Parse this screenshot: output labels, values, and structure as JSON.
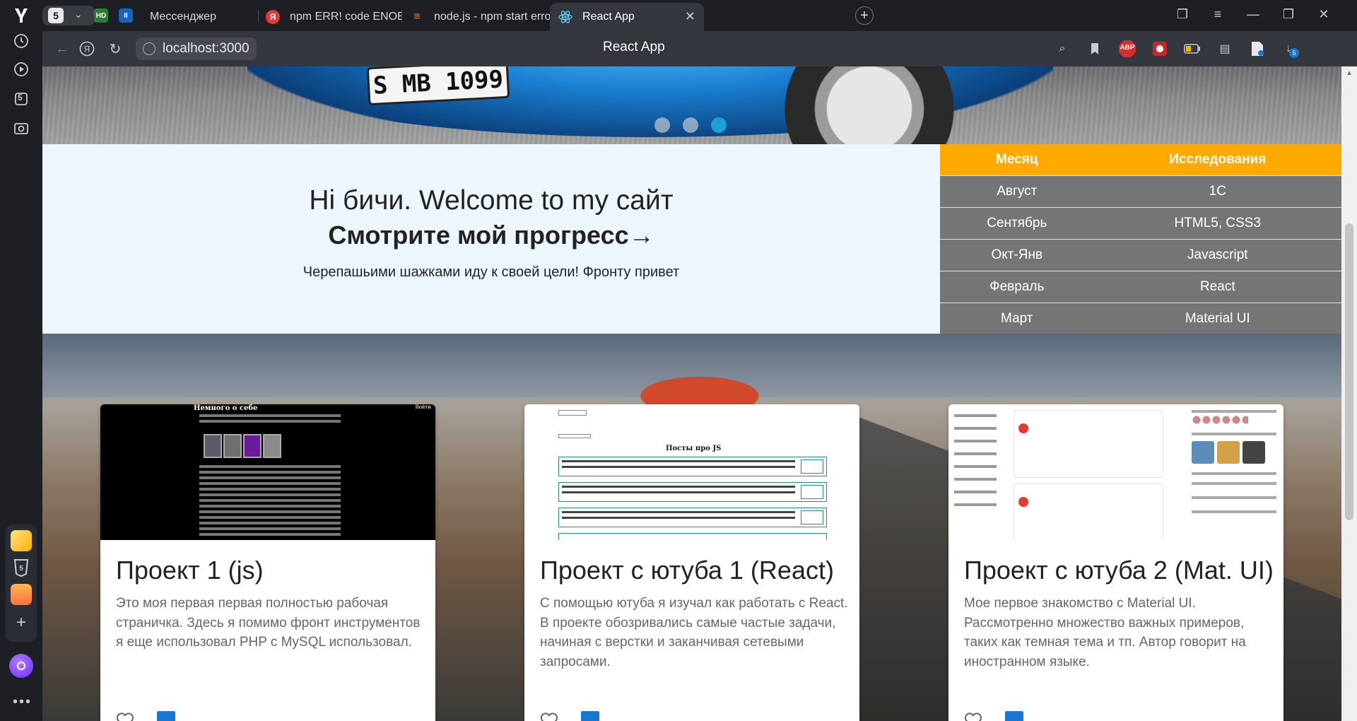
{
  "browser": {
    "tab_count": "5",
    "tabs": [
      {
        "label": "Мессенджер"
      },
      {
        "label": "npm ERR! code ENOENT npm"
      },
      {
        "label": "node.js - npm start errors w"
      },
      {
        "label": "React App"
      }
    ],
    "url": "localhost:3000",
    "page_title": "React App",
    "ext_badges": {
      "abp": "ABP",
      "downloads": "5"
    },
    "sidebar_badge": "5"
  },
  "hero": {
    "plate": "S MB 1099"
  },
  "welcome": {
    "line1": "Hi бичи. Welcome to my сайт",
    "line2": "Смотрите мой прогресс→",
    "line3": "Черепашьими шажками иду к своей цели! Фронту привет"
  },
  "study_table": {
    "headers": [
      "Месяц",
      "Исследования"
    ],
    "rows": [
      [
        "Август",
        "1С"
      ],
      [
        "Сентябрь",
        "HTML5, CSS3"
      ],
      [
        "Окт-Янв",
        "Javascript"
      ],
      [
        "Февраль",
        "React"
      ],
      [
        "Март",
        "Material UI"
      ]
    ]
  },
  "projects": [
    {
      "title": "Проект 1 (js)",
      "desc": "Это моя первая первая полностью рабочая страничка. Здесь я помимо фронт инструментов я еще использовал PHP с MySQL использовал.",
      "thumb_title": "Немного о себе",
      "thumb_login": "Войти"
    },
    {
      "title": "Проект с ютуба 1 (React)",
      "desc": "С помощью ютуба я изучал как работать с React. В проекте обозривались самые частые задачи, начиная с верстки и заканчивая сетевыми запросами.",
      "thumb_title": "Посты про JS"
    },
    {
      "title": "Проект с ютуба 2 (Mat. UI)",
      "desc": "Мое первое знакомство с Material UI. Рассмотренно множество важных примеров, таких как темная тема и тп. Автор говорит на иностранном языке."
    }
  ],
  "colors": {
    "table_header": "#ffaa00",
    "table_cell": "#757575",
    "welcome_bg": "#eef6fd",
    "active_dot": "#1f9fd6",
    "card_action": "#1976d2"
  }
}
